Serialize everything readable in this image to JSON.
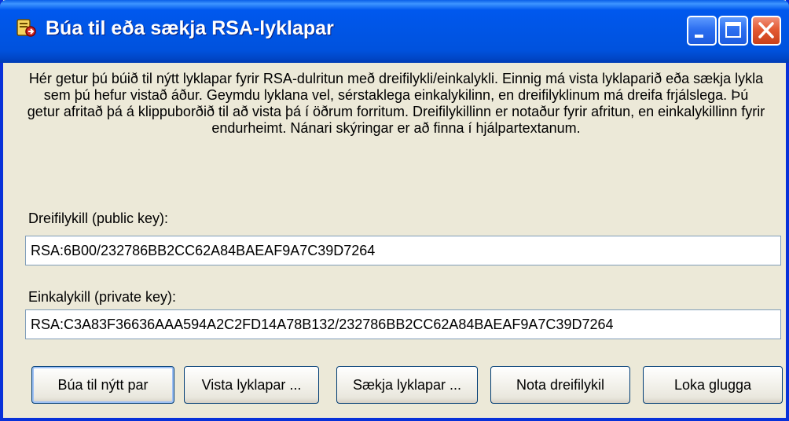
{
  "window": {
    "title": "Búa til eða sækja RSA-lyklapar"
  },
  "titlebar_buttons": {
    "minimize_icon": "minimize-icon",
    "maximize_icon": "maximize-icon",
    "close_icon": "close-icon"
  },
  "description": "Hér getur þú búið til nýtt lyklapar fyrir RSA-dulritun með dreifilykli/einkalykli.  Einnig má vista lyklaparið eða sækja lykla sem þú hefur vistað áður.  Geymdu lyklana vel, sérstaklega einkalykilinn, en dreifilyklinum má dreifa frjálslega.  Þú getur afritað þá á klippuborðið til að vista þá í öðrum forritum. Dreifilykillinn er notaður fyrir afritun, en einkalykillinn fyrir endurheimt.  Nánari skýringar er að finna í hjálpartextanum.",
  "public_key": {
    "label": "Dreifilykill (public key):",
    "value": "RSA:6B00/232786BB2CC62A84BAEAF9A7C39D7264"
  },
  "private_key": {
    "label": "Einkalykill (private key):",
    "value": "RSA:C3A83F36636AAA594A2C2FD14A78B132/232786BB2CC62A84BAEAF9A7C39D7264"
  },
  "buttons": {
    "new_pair": "Búa til nýtt par",
    "save_pair": "Vista lyklapar ...",
    "load_pair": "Sækja lyklapar ...",
    "use_public": "Nota dreifilykil",
    "close_window": "Loka glugga"
  },
  "colors": {
    "titlebar": "#0055E5",
    "window_face": "#ECE9D8",
    "close_button": "#E35A33"
  }
}
